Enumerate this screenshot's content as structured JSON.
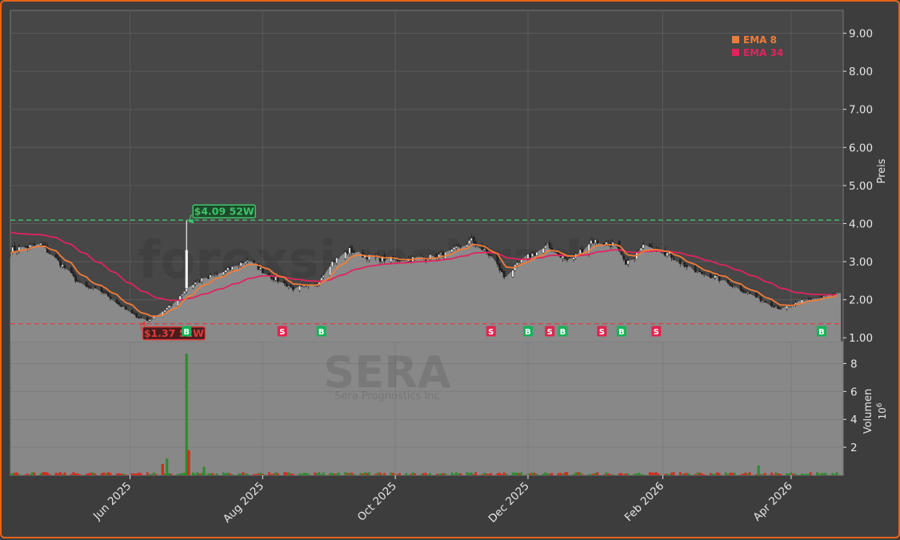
{
  "chart_data": {
    "type": "candlestick",
    "ticker": "SERA",
    "company": "Sera Prognostics Inc",
    "watermark": "forexsignaltrade",
    "price_axis": {
      "label": "Preis",
      "ylim": [
        0.9,
        9.6
      ],
      "ticks": [
        1,
        2,
        3,
        4,
        5,
        6,
        7,
        8,
        9
      ],
      "tick_labels": [
        "1.00",
        "2.00",
        "3.00",
        "4.00",
        "5.00",
        "6.00",
        "7.00",
        "8.00",
        "9.00"
      ]
    },
    "volume_axis": {
      "label": "Volumen",
      "exponent": "10",
      "exponent_power": "6",
      "ylim": [
        0,
        9.0
      ],
      "ticks": [
        2,
        4,
        6,
        8
      ],
      "tick_labels": [
        "2",
        "4",
        "6",
        "8"
      ]
    },
    "time_axis": {
      "start": "2025-04-07",
      "end": "2026-04-22",
      "ticks": [
        {
          "date": "2025-06-01",
          "label": "Jun 2025"
        },
        {
          "date": "2025-08-01",
          "label": "Aug 2025"
        },
        {
          "date": "2025-10-01",
          "label": "Oct 2025"
        },
        {
          "date": "2025-12-01",
          "label": "Dec 2025"
        },
        {
          "date": "2026-02-01",
          "label": "Feb 2026"
        },
        {
          "date": "2026-04-01",
          "label": "Apr 2026"
        }
      ]
    },
    "legend": {
      "placement": "top-right",
      "items": [
        {
          "label": "EMA 8",
          "color": "#f07c3a"
        },
        {
          "label": "EMA 34",
          "color": "#e0245e"
        }
      ]
    },
    "levels": [
      {
        "name": "52w-high",
        "value": 4.09,
        "label": "$4.09 52W",
        "color": "#3cc46a",
        "date": "2025-06-27"
      },
      {
        "name": "52w-low",
        "value": 1.37,
        "label": "$1.37 52W",
        "color": "#e03b3b",
        "date": "2025-06-05"
      }
    ],
    "close_anchors": [
      [
        "2025-04-07",
        3.3
      ],
      [
        "2025-04-21",
        3.45
      ],
      [
        "2025-05-01",
        2.9
      ],
      [
        "2025-05-10",
        2.35
      ],
      [
        "2025-05-20",
        2.2
      ],
      [
        "2025-06-01",
        1.65
      ],
      [
        "2025-06-09",
        1.45
      ],
      [
        "2025-06-20",
        1.85
      ],
      [
        "2025-06-27",
        2.3
      ],
      [
        "2025-07-01",
        2.45
      ],
      [
        "2025-07-15",
        2.75
      ],
      [
        "2025-07-25",
        3.05
      ],
      [
        "2025-08-05",
        2.6
      ],
      [
        "2025-08-15",
        2.3
      ],
      [
        "2025-08-25",
        2.35
      ],
      [
        "2025-09-01",
        2.95
      ],
      [
        "2025-09-10",
        3.3
      ],
      [
        "2025-09-20",
        3.1
      ],
      [
        "2025-10-01",
        3.05
      ],
      [
        "2025-10-15",
        3.1
      ],
      [
        "2025-10-25",
        3.2
      ],
      [
        "2025-11-05",
        3.55
      ],
      [
        "2025-11-15",
        3.1
      ],
      [
        "2025-11-20",
        2.6
      ],
      [
        "2025-11-30",
        3.1
      ],
      [
        "2025-12-10",
        3.4
      ],
      [
        "2025-12-20",
        3.0
      ],
      [
        "2025-12-30",
        3.55
      ],
      [
        "2026-01-10",
        3.45
      ],
      [
        "2026-01-15",
        2.9
      ],
      [
        "2026-01-25",
        3.5
      ],
      [
        "2026-02-05",
        3.15
      ],
      [
        "2026-02-15",
        2.75
      ],
      [
        "2026-02-25",
        2.6
      ],
      [
        "2026-03-08",
        2.3
      ],
      [
        "2026-03-20",
        1.95
      ],
      [
        "2026-03-28",
        1.75
      ],
      [
        "2026-04-08",
        2.0
      ],
      [
        "2026-04-22",
        2.15
      ]
    ],
    "volume_spikes": [
      {
        "date": "2025-06-27",
        "value": 8.7,
        "direction": "up"
      },
      {
        "date": "2025-06-28",
        "value": 1.8,
        "direction": "down"
      },
      {
        "date": "2025-06-18",
        "value": 1.2,
        "direction": "up"
      },
      {
        "date": "2025-06-16",
        "value": 0.8,
        "direction": "down"
      },
      {
        "date": "2025-07-05",
        "value": 0.6,
        "direction": "up"
      },
      {
        "date": "2026-03-17",
        "value": 0.7,
        "direction": "up"
      }
    ],
    "signals": [
      {
        "date": "2025-06-27",
        "type": "B"
      },
      {
        "date": "2025-08-10",
        "type": "S"
      },
      {
        "date": "2025-08-28",
        "type": "B"
      },
      {
        "date": "2025-11-14",
        "type": "S"
      },
      {
        "date": "2025-12-01",
        "type": "B"
      },
      {
        "date": "2025-12-11",
        "type": "S"
      },
      {
        "date": "2025-12-17",
        "type": "B"
      },
      {
        "date": "2026-01-04",
        "type": "S"
      },
      {
        "date": "2026-01-13",
        "type": "B"
      },
      {
        "date": "2026-01-29",
        "type": "S"
      },
      {
        "date": "2026-04-15",
        "type": "B"
      }
    ],
    "colors": {
      "up": "#2e8b2e",
      "down": "#d42a1a",
      "area": "#8a8a8a",
      "grid": "#5a5a5a",
      "buy": "#17b35a",
      "sell": "#e0244e"
    }
  }
}
